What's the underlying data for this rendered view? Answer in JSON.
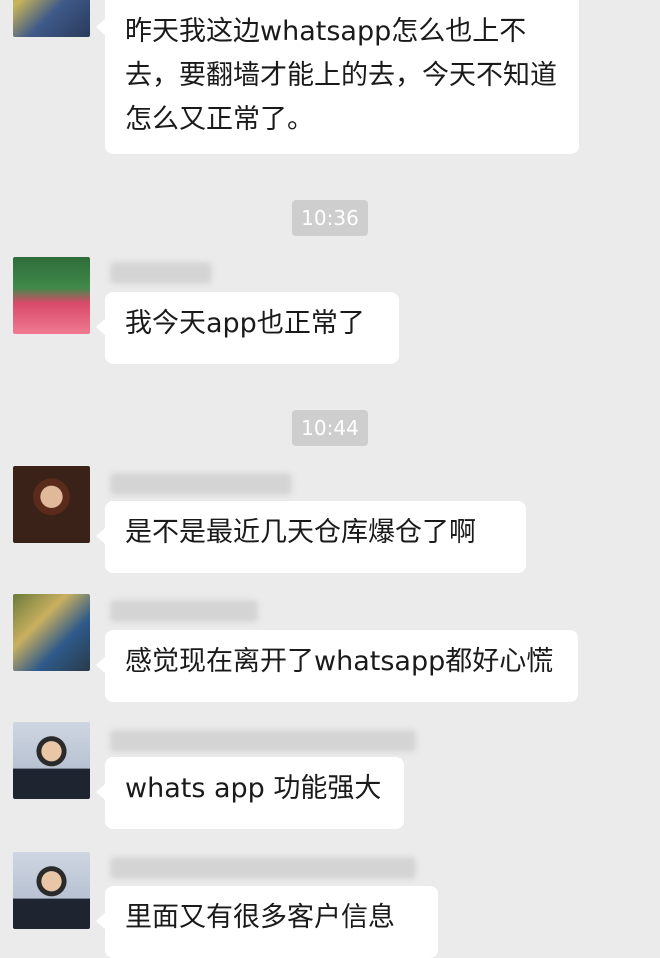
{
  "messages": [
    {
      "text": "昨天我这边whatsapp怎么也上不去，要翻墙才能上的去，今天不知道怎么又正常了。"
    },
    {
      "text": "我今天app也正常了"
    },
    {
      "text": "是不是最近几天仓库爆仓了啊"
    },
    {
      "text": "感觉现在离开了whatsapp都好心慌"
    },
    {
      "text": "whats app 功能强大"
    },
    {
      "text": "里面又有很多客户信息"
    }
  ],
  "timestamps": [
    "10:36",
    "10:44"
  ]
}
